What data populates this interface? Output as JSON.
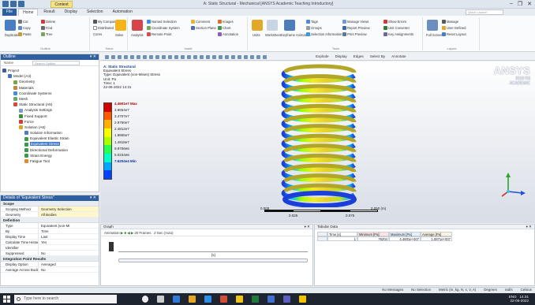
{
  "window": {
    "title": "A: Static Structural - Mechanical [ANSYS Academic Teaching Introductory]",
    "context_tab": "Context",
    "controls": [
      "–",
      "❐",
      "✕"
    ]
  },
  "ribbon": {
    "tabs": [
      "File",
      "Home",
      "Result",
      "Display",
      "Selection",
      "Automation"
    ],
    "active_tab": "Home",
    "quick_launch": "Quick Launch",
    "groups": [
      {
        "label": "Outline",
        "buttons": [
          "Duplicate",
          "Cut",
          "Copy",
          "Paste",
          "Delete",
          "Find",
          "Tree"
        ]
      },
      {
        "label": "Solve",
        "buttons": [
          "My Computer",
          "Distributed",
          "Cores",
          "Solve"
        ]
      },
      {
        "label": "Insert",
        "buttons": [
          "Analysis",
          "Named Selection",
          "Coordinate System",
          "Remote Point",
          "Comment",
          "Section Plane",
          "Images",
          "Chart",
          "Annotation"
        ]
      },
      {
        "label": "Tools",
        "buttons": [
          "Units",
          "Worksheet",
          "Keyframe Animation",
          "Tags",
          "Groups",
          "Selection Information",
          "Manage Views",
          "Report Preview",
          "Print Preview",
          "Show Errors",
          "Unit Converter",
          "Key Assignments"
        ]
      },
      {
        "label": "Layout",
        "buttons": [
          "Full Screen",
          "Manage",
          "User Defined",
          "Reset Layout"
        ]
      }
    ]
  },
  "outline": {
    "title": "Outline",
    "name_label": "Name",
    "search_placeholder": "Search Outline",
    "tree": [
      {
        "label": "Project",
        "level": 0,
        "icon": "project-icon"
      },
      {
        "label": "Model (A4)",
        "level": 1,
        "icon": "model-icon"
      },
      {
        "label": "Geometry",
        "level": 2,
        "icon": "geometry-icon"
      },
      {
        "label": "Materials",
        "level": 2,
        "icon": "materials-icon"
      },
      {
        "label": "Coordinate Systems",
        "level": 2,
        "icon": "coordinate-icon"
      },
      {
        "label": "Mesh",
        "level": 2,
        "icon": "mesh-icon"
      },
      {
        "label": "Static Structural (A5)",
        "level": 2,
        "icon": "analysis-icon"
      },
      {
        "label": "Analysis Settings",
        "level": 3,
        "icon": "settings-icon"
      },
      {
        "label": "Fixed Support",
        "level": 3,
        "icon": "support-icon"
      },
      {
        "label": "Force",
        "level": 3,
        "icon": "force-icon"
      },
      {
        "label": "Solution (A6)",
        "level": 3,
        "icon": "solution-icon"
      },
      {
        "label": "Solution Information",
        "level": 4,
        "icon": "info-icon"
      },
      {
        "label": "Equivalent Elastic Strain",
        "level": 4,
        "icon": "result-icon"
      },
      {
        "label": "Equivalent Stress",
        "level": 4,
        "icon": "result-icon",
        "selected": true
      },
      {
        "label": "Directional Deformation",
        "level": 4,
        "icon": "result-icon"
      },
      {
        "label": "Strain Energy",
        "level": 4,
        "icon": "result-icon"
      },
      {
        "label": "Fatigue Tool",
        "level": 4,
        "icon": "fatigue-icon"
      }
    ]
  },
  "details": {
    "title": "Details of \"Equivalent Stress\"",
    "sections": [
      {
        "name": "Scope",
        "rows": [
          [
            "Scoping Method",
            "Geometry Selection"
          ],
          [
            "Geometry",
            "All Bodies"
          ]
        ]
      },
      {
        "name": "Definition",
        "rows": [
          [
            "Type",
            "Equivalent (von-Mi"
          ],
          [
            "By",
            "Time"
          ],
          [
            "Display Time",
            "Last"
          ],
          [
            "Calculate Time History",
            "Yes"
          ],
          [
            "Identifier",
            ""
          ],
          [
            "Suppressed",
            "No"
          ]
        ]
      },
      {
        "name": "Integration Point Results",
        "rows": [
          [
            "Display Option",
            "Averaged"
          ],
          [
            "Average Across Bodies",
            "No"
          ]
        ]
      }
    ]
  },
  "viewport": {
    "toolbar_right": [
      "Explode",
      "Display",
      "Edges",
      "Select By",
      "Annotate"
    ],
    "result_info": [
      "A: Static Structural",
      "Equivalent Stress",
      "Type: Equivalent (von-Mises) Stress",
      "Unit: Pa",
      "Time: 1",
      "22-06-2022 14:31"
    ],
    "legend": {
      "max_label": "4.4601e7 Max",
      "values": [
        "3.9654e7",
        "3.4707e7",
        "2.9760e7",
        "2.4812e7",
        "1.9865e7",
        "1.4918e7",
        "9.9706e6",
        "5.0234e6"
      ],
      "min_label": "7.6204e4 Min",
      "colors": [
        "#d40000",
        "#ff5a00",
        "#ffb000",
        "#f5ff00",
        "#a8ff00",
        "#26ff4d",
        "#00ffc8",
        "#00a5ff",
        "#0040ff"
      ]
    },
    "scale": {
      "top": [
        "0.000",
        "0.050 (m)"
      ],
      "bottom": [
        "0.025",
        "0.075"
      ]
    },
    "brand": {
      "name": "ANSYS",
      "release": "2019 R3",
      "edition": "ACADEMIC"
    }
  },
  "graph_panel": {
    "title": "Graph",
    "toolbar": "Animation",
    "frames": "20 Frames",
    "duration": "2 Sec (Auto)",
    "axis_label": "[s]"
  },
  "tabular_panel": {
    "title": "Tabular Data",
    "headers": [
      "Time [s]",
      "Minimum [Pa]",
      "Maximum [Pa]",
      "Average [Pa]"
    ],
    "rows": [
      [
        "1",
        "76204",
        "4.4601e+007",
        "1.0871e+007"
      ]
    ]
  },
  "status_bar": [
    "No Messages",
    "No Selection",
    "Metric (m, kg, N, s, V, A)",
    "Degrees",
    "rad/s",
    "Celsius"
  ],
  "taskbar": {
    "search_placeholder": "Type here to search",
    "time": "14:31",
    "date": "22-06-2022",
    "lang": "ENG"
  }
}
